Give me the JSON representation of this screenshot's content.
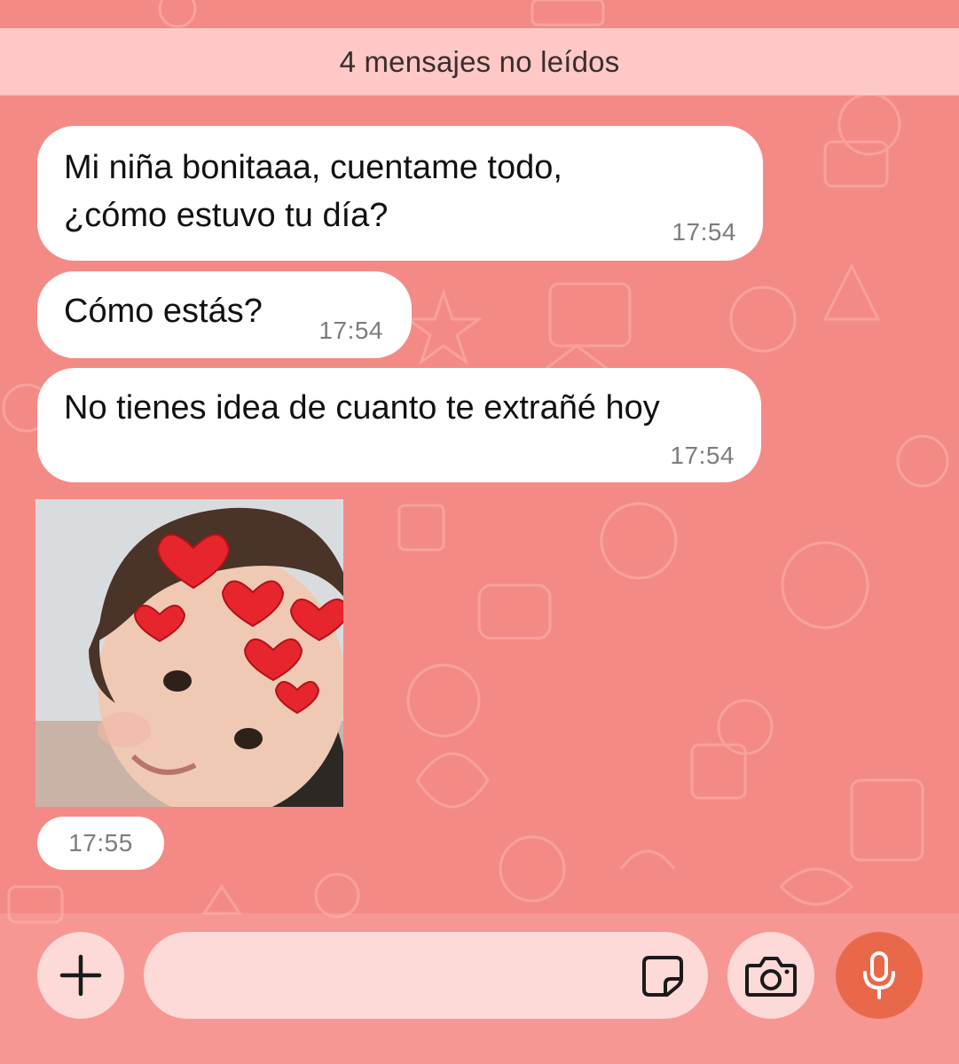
{
  "banner": {
    "unread_text": "4 mensajes no leídos"
  },
  "messages": [
    {
      "lines": [
        "Mi niña bonitaaa, cuentame todo,",
        "¿cómo estuvo tu día?"
      ],
      "time": "17:54"
    },
    {
      "lines": [
        "Cómo estás?"
      ],
      "time": "17:54"
    },
    {
      "lines": [
        "No tienes idea de cuanto te extrañé hoy"
      ],
      "time": "17:54"
    }
  ],
  "photo_message": {
    "time": "17:55"
  },
  "composer": {
    "placeholder": "",
    "icons": {
      "attach": "plus-icon",
      "sticker": "sticker-icon",
      "camera": "camera-icon",
      "voice": "microphone-icon"
    }
  },
  "colors": {
    "wallpaper": "#f48a86",
    "bubble": "#ffffff",
    "mic_button": "#e9684a",
    "button_bg": "#fdd9d7"
  }
}
